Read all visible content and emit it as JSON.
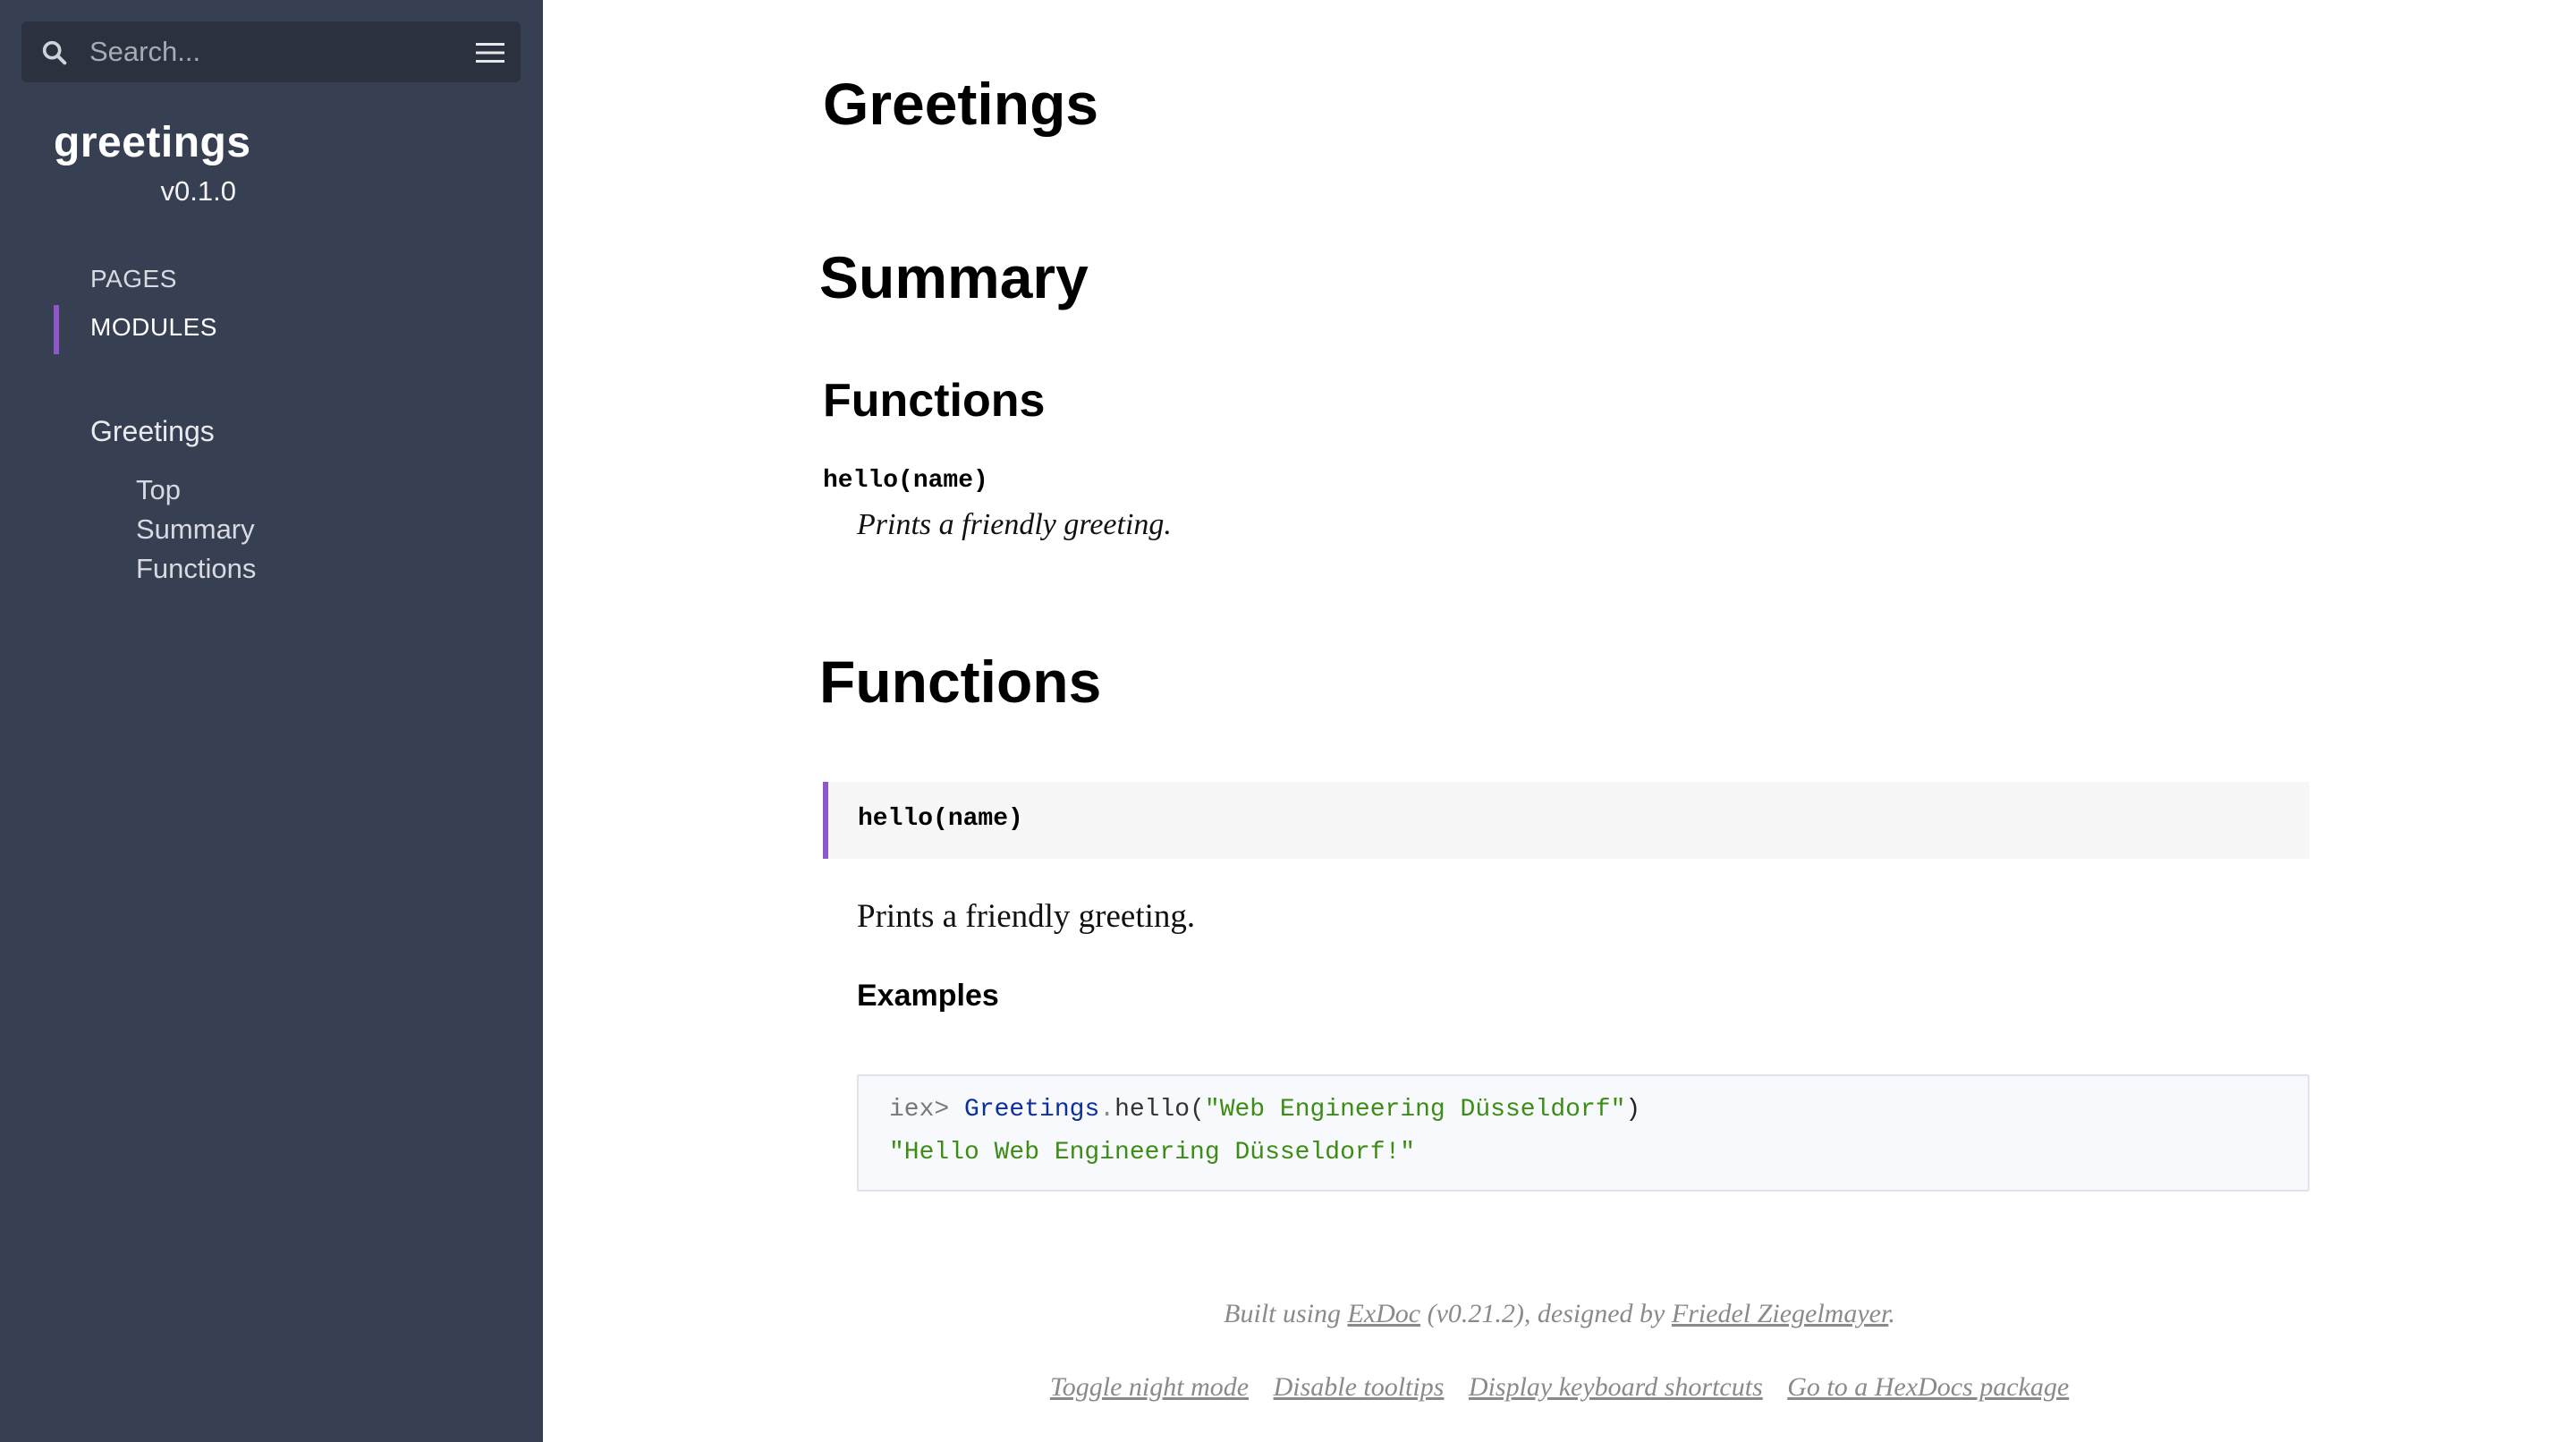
{
  "sidebar": {
    "search": {
      "placeholder": "Search..."
    },
    "project": {
      "name": "greetings",
      "version": "v0.1.0"
    },
    "tabs": [
      {
        "label": "PAGES",
        "active": false
      },
      {
        "label": "MODULES",
        "active": true
      }
    ],
    "module": {
      "name": "Greetings",
      "sections": [
        "Top",
        "Summary",
        "Functions"
      ]
    },
    "icons": {
      "search": "search-icon",
      "menu": "hamburger-menu-icon"
    },
    "colors": {
      "background": "#373f52",
      "accent": "#8e58cb"
    }
  },
  "content": {
    "title": "Greetings",
    "summary": {
      "heading": "Summary",
      "functions_heading": "Functions",
      "signature": "hello(name)",
      "doc": "Prints a friendly greeting."
    },
    "functions": {
      "heading": "Functions",
      "signature": "hello(name)",
      "doc": "Prints a friendly greeting.",
      "examples_heading": "Examples",
      "code": {
        "prompt": "iex> ",
        "module": "Greetings",
        "dot": ".",
        "call": "hello(",
        "arg": "\"Web Engineering Düsseldorf\"",
        "close": ")",
        "result": "\"Hello Web Engineering Düsseldorf!\""
      }
    },
    "footer": {
      "built_prefix": "Built using ",
      "exdoc_link": "ExDoc",
      "built_middle": " (v0.21.2), designed by ",
      "author_link": "Friedel Ziegelmayer",
      "built_suffix": ".",
      "links": [
        "Toggle night mode",
        "Disable tooltips",
        "Display keyboard shortcuts",
        "Go to a HexDocs package"
      ]
    }
  }
}
